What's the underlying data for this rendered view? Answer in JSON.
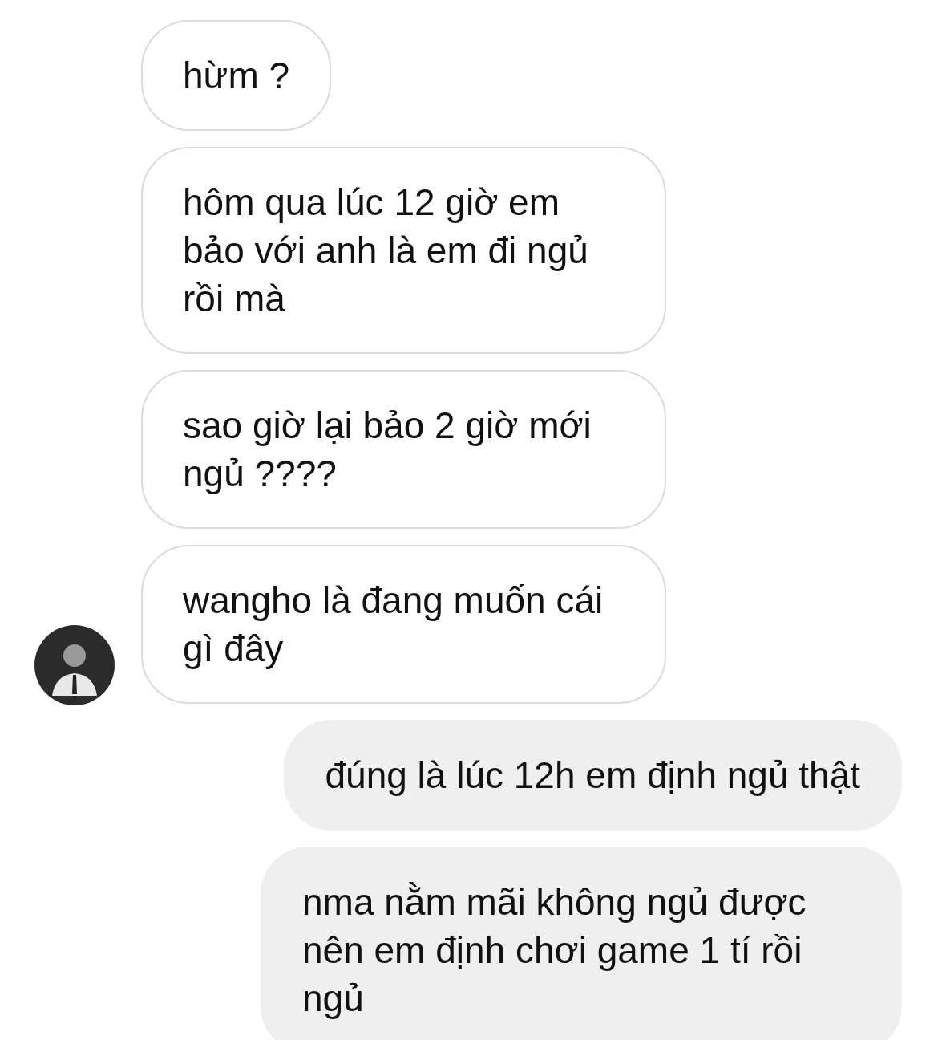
{
  "messages": [
    {
      "kind": "incoming",
      "avatar": false,
      "text": "hừm ?"
    },
    {
      "kind": "incoming",
      "avatar": false,
      "text": "hôm qua lúc 12 giờ em bảo với anh là em đi ngủ rồi mà"
    },
    {
      "kind": "incoming",
      "avatar": false,
      "text": "sao giờ lại bảo 2 giờ mới ngủ ????"
    },
    {
      "kind": "incoming",
      "avatar": true,
      "text": "wangho là đang muốn cái gì đây"
    },
    {
      "kind": "outgoing",
      "avatar": false,
      "text": "đúng là lúc 12h em định ngủ thật"
    },
    {
      "kind": "outgoing",
      "avatar": false,
      "text": "nma nằm mãi không ngủ được nên em định chơi game 1 tí rồi ngủ"
    }
  ]
}
